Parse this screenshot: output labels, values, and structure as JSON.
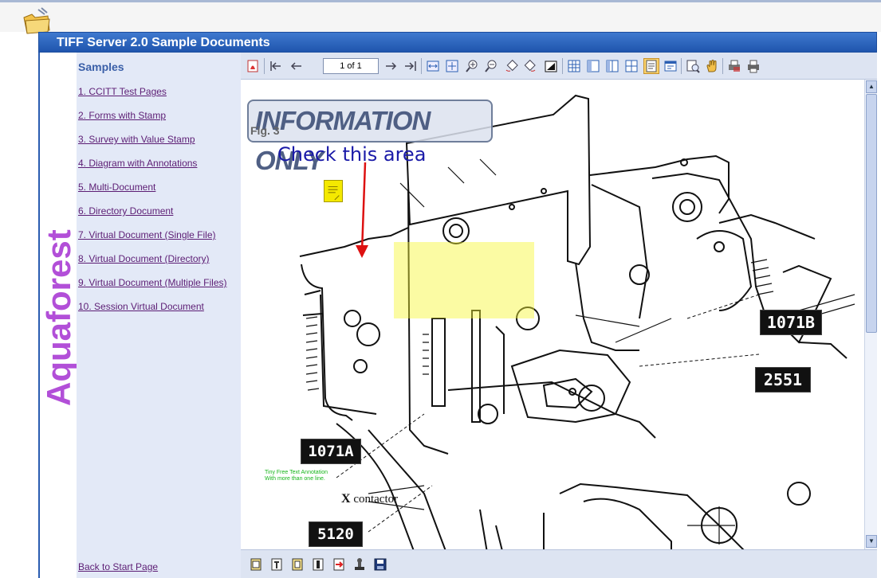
{
  "app": {
    "title": "TIFF Server 2.0 Sample Documents"
  },
  "brand": {
    "logo_text": "Aquaforest"
  },
  "sidebar": {
    "title": "Samples",
    "items": [
      {
        "label": "1. CCITT Test Pages"
      },
      {
        "label": "2. Forms with Stamp"
      },
      {
        "label": "3. Survey with Value Stamp"
      },
      {
        "label": "4. Diagram with Annotations"
      },
      {
        "label": "5. Multi-Document"
      },
      {
        "label": "6. Directory Document"
      },
      {
        "label": "7. Virtual Document (Single File)"
      },
      {
        "label": "8. Virtual Document (Directory)"
      },
      {
        "label": "9. Virtual Document (Multiple Files)"
      },
      {
        "label": "10. Session Virtual Document"
      }
    ],
    "back_link": "Back to Start Page"
  },
  "toolbar": {
    "page_indicator": "1 of 1",
    "icons": [
      "pdf-icon",
      "first-page-icon",
      "previous-page-icon",
      "next-page-icon",
      "last-page-icon",
      "fit-width-icon",
      "fit-page-icon",
      "zoom-in-icon",
      "zoom-out-icon",
      "rotate-left-icon",
      "rotate-right-icon",
      "invert-icon",
      "thumbnails-icon",
      "single-page-icon",
      "two-page-icon",
      "continuous-icon",
      "annotations-icon",
      "info-icon",
      "magnifier-icon",
      "pan-hand-icon",
      "print-preview-icon",
      "print-icon"
    ]
  },
  "document": {
    "stamp": "INFORMATION ONLY",
    "fig_label": "Fig. 3",
    "annotation_text": "Check this area",
    "tiny_note_line1": "Tiny Free Text Annotation",
    "tiny_note_line2": "With more than one line.",
    "labels": [
      "1071B",
      "2551",
      "1071A",
      "5120"
    ],
    "contactor_x": "X",
    "contactor_word": "contactor"
  },
  "colors": {
    "title_bar": "#2c63bf",
    "sidebar_bg": "#e3e9f7",
    "link": "#5c1d74",
    "brand": "#b24fd8",
    "annotation_text": "#1a1aa8",
    "highlight": "#f7f732"
  }
}
